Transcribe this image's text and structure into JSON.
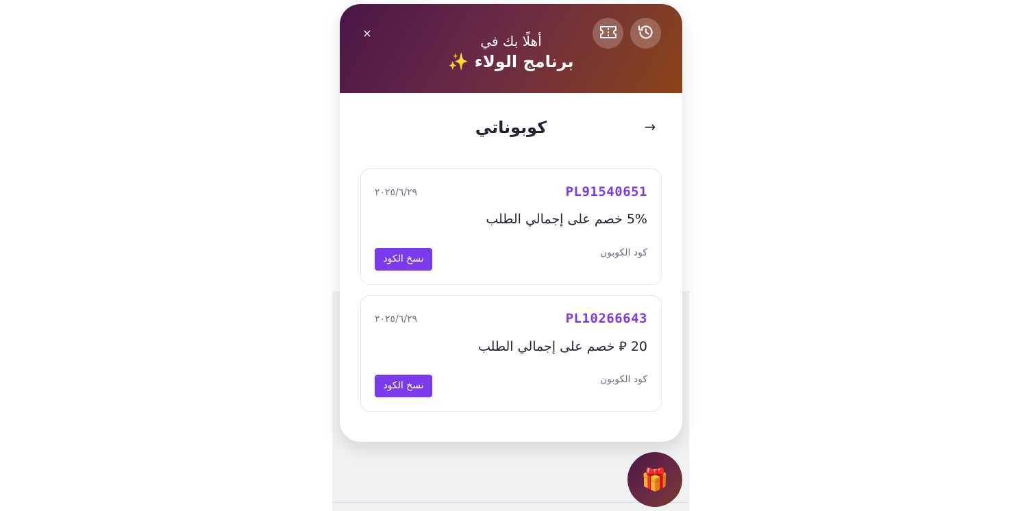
{
  "header": {
    "welcome": "أهلًا بك في",
    "program": "برنامج الولاء ✨",
    "close_symbol": "×",
    "gradient_colors": [
      "#4a1647",
      "#8a4418"
    ]
  },
  "header_buttons": {
    "ticket_icon": "ticket-icon",
    "history_icon": "history-icon"
  },
  "section": {
    "title": "كوبوناتي",
    "back_symbol": "→"
  },
  "coupons": [
    {
      "code": "PL91540651",
      "date": "٢٠٢٥/٦/٢٩",
      "description": "5% خصم على إجمالي الطلب",
      "label": "كود الكوبون",
      "copy_label": "نسخ الكود"
    },
    {
      "code": "PL10266643",
      "date": "٢٠٢٥/٦/٢٩",
      "description": "20 ⃁ خصم على إجمالي الطلب",
      "label": "كود الكوبون",
      "copy_label": "نسخ الكود"
    }
  ],
  "fab": {
    "icon": "gift-icon",
    "glyph": "🎁"
  },
  "colors": {
    "accent": "#7c3aed"
  }
}
